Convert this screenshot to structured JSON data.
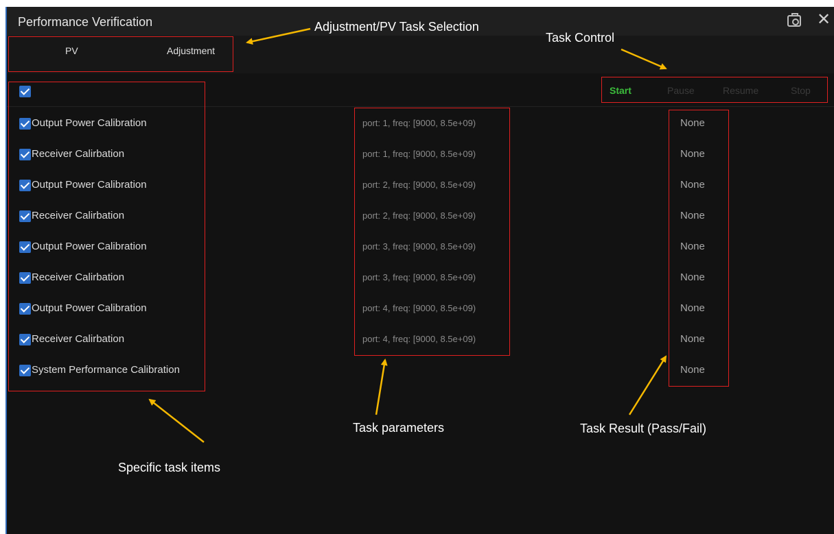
{
  "window": {
    "title": "Performance Verification"
  },
  "tabs": [
    "PV",
    "Adjustment"
  ],
  "controls": {
    "start": "Start",
    "pause": "Pause",
    "resume": "Resume",
    "stop": "Stop",
    "start_color": "#3cbd3c",
    "disabled_color": "#3a3a3a"
  },
  "tasks": [
    {
      "name": "Output Power Calibration",
      "params": "port: 1, freq: [9000, 8.5e+09)",
      "result": "None"
    },
    {
      "name": "Receiver Calirbation",
      "params": "port: 1, freq: [9000, 8.5e+09)",
      "result": "None"
    },
    {
      "name": "Output Power Calibration",
      "params": "port: 2, freq: [9000, 8.5e+09)",
      "result": "None"
    },
    {
      "name": "Receiver Calirbation",
      "params": "port: 2, freq: [9000, 8.5e+09)",
      "result": "None"
    },
    {
      "name": "Output Power Calibration",
      "params": "port: 3, freq: [9000, 8.5e+09)",
      "result": "None"
    },
    {
      "name": "Receiver Calirbation",
      "params": "port: 3, freq: [9000, 8.5e+09)",
      "result": "None"
    },
    {
      "name": "Output Power Calibration",
      "params": "port: 4, freq: [9000, 8.5e+09)",
      "result": "None"
    },
    {
      "name": "Receiver Calirbation",
      "params": "port: 4, freq: [9000, 8.5e+09)",
      "result": "None"
    },
    {
      "name": "System Performance Calibration",
      "params": "",
      "result": "None"
    }
  ],
  "annotations": {
    "tab_selection": "Adjustment/PV Task Selection",
    "task_control": "Task Control",
    "task_items": "Specific task items",
    "task_parameters": "Task parameters",
    "task_result": "Task Result (Pass/Fail)",
    "arrow_color": "#f5b800",
    "box_color": "#e02020"
  }
}
